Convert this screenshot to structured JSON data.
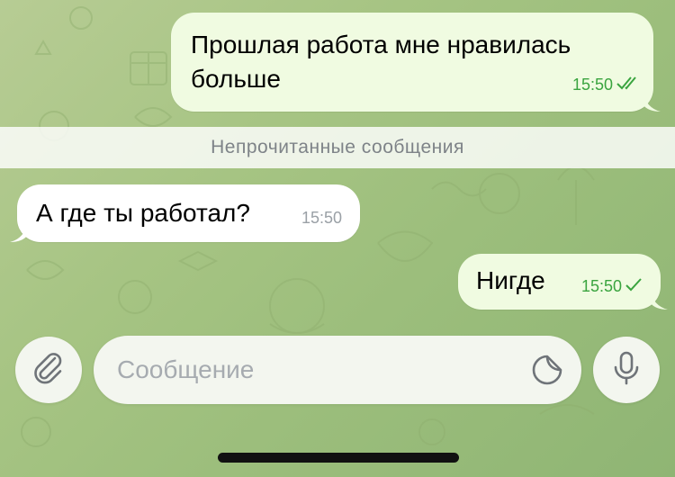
{
  "messages": [
    {
      "direction": "outgoing",
      "lines": [
        "Прошлая работа мне нравилась",
        "больше"
      ],
      "time": "15:50",
      "status": "read",
      "status_icon": "double-check-icon"
    },
    {
      "direction": "incoming",
      "text": "А где ты работал?",
      "time": "15:50"
    },
    {
      "direction": "outgoing",
      "text": "Нигде",
      "time": "15:50",
      "status": "sent",
      "status_icon": "single-check-icon"
    }
  ],
  "unread_banner": "Непрочитанные сообщения",
  "composer": {
    "placeholder": "Сообщение",
    "attach_icon": "paperclip-icon",
    "sticker_icon": "sticker-icon",
    "mic_icon": "microphone-icon"
  },
  "colors": {
    "outgoing_bubble": "#f0fbe1",
    "incoming_bubble": "#ffffff",
    "check_green": "#3aa43f",
    "wallpaper": "#a6c483"
  }
}
